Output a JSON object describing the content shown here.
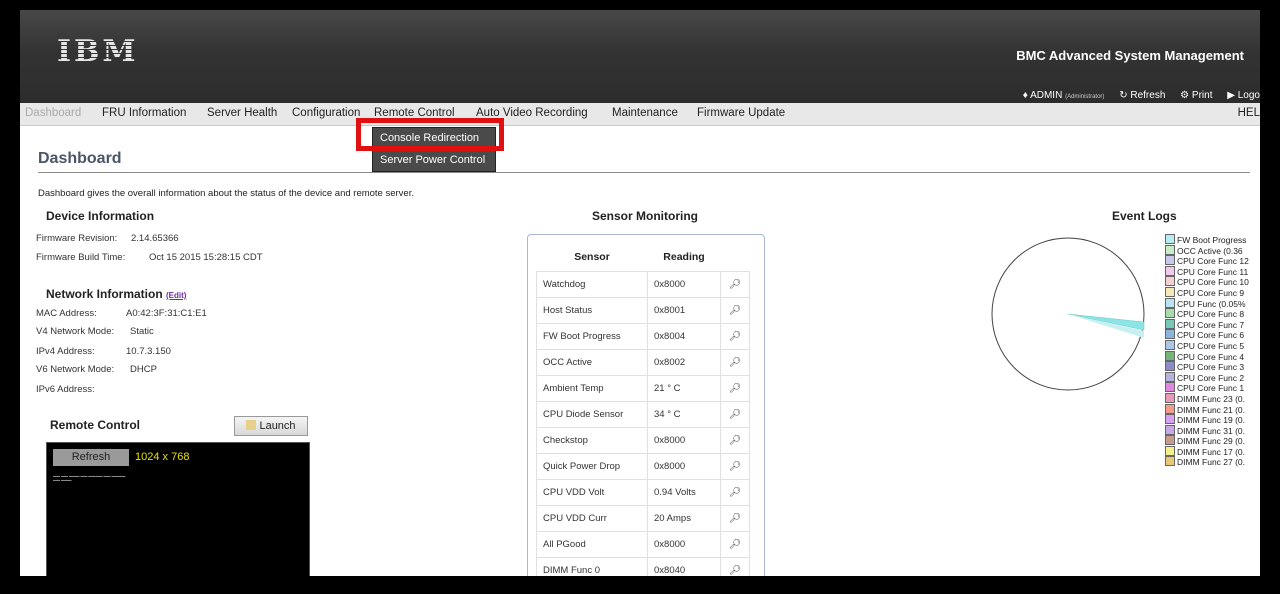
{
  "header": {
    "logo": "IBM",
    "product": "BMC Advanced System Management",
    "user": "ADMIN",
    "role": "(Administrator)",
    "refresh": "Refresh",
    "print": "Print",
    "logout": "Logo"
  },
  "nav": {
    "items": [
      "Dashboard",
      "FRU Information",
      "Server Health",
      "Configuration",
      "Remote Control",
      "Auto Video Recording",
      "Maintenance",
      "Firmware Update"
    ],
    "help": "HEL"
  },
  "submenu": {
    "items": [
      "Console Redirection",
      "Server Power Control"
    ]
  },
  "page": {
    "title": "Dashboard",
    "description": "Dashboard gives the overall information about the status of the device and remote server."
  },
  "device": {
    "heading": "Device Information",
    "fw_rev_label": "Firmware Revision:",
    "fw_rev": "2.14.65366",
    "fw_build_label": "Firmware Build Time:",
    "fw_build": "Oct 15 2015 15:28:15 CDT"
  },
  "network": {
    "heading": "Network Information",
    "edit": "(Edit)",
    "mac_label": "MAC Address:",
    "mac": "A0:42:3F:31:C1:E1",
    "v4mode_label": "V4 Network Mode:",
    "v4mode": "Static",
    "ipv4_label": "IPv4 Address:",
    "ipv4": "10.7.3.150",
    "v6mode_label": "V6 Network Mode:",
    "v6mode": "DHCP",
    "ipv6_label": "IPv6 Address:",
    "ipv6": ""
  },
  "remote": {
    "heading": "Remote Control",
    "launch": "Launch",
    "refresh": "Refresh",
    "resolution": "1024 x 768"
  },
  "sensors": {
    "heading": "Sensor Monitoring",
    "col_sensor": "Sensor",
    "col_reading": "Reading",
    "rows": [
      {
        "name": "Watchdog",
        "reading": "0x8000"
      },
      {
        "name": "Host Status",
        "reading": "0x8001"
      },
      {
        "name": "FW Boot Progress",
        "reading": "0x8004"
      },
      {
        "name": "OCC Active",
        "reading": "0x8002"
      },
      {
        "name": "Ambient Temp",
        "reading": "21 ° C"
      },
      {
        "name": "CPU Diode Sensor",
        "reading": "34 ° C"
      },
      {
        "name": "Checkstop",
        "reading": "0x8000"
      },
      {
        "name": "Quick Power Drop",
        "reading": "0x8000"
      },
      {
        "name": "CPU VDD Volt",
        "reading": "0.94 Volts"
      },
      {
        "name": "CPU VDD Curr",
        "reading": "20 Amps"
      },
      {
        "name": "All PGood",
        "reading": "0x8000"
      },
      {
        "name": "DIMM Func 0",
        "reading": "0x8040"
      }
    ]
  },
  "events": {
    "heading": "Event Logs",
    "legend": [
      {
        "label": "FW Boot Progress",
        "color": "#b8ecf4"
      },
      {
        "label": "OCC Active (0.36",
        "color": "#c8ecc8"
      },
      {
        "label": "CPU Core Func 12",
        "color": "#c8c8ec"
      },
      {
        "label": "CPU Core Func 11",
        "color": "#f4c8ec"
      },
      {
        "label": "CPU Core Func 10",
        "color": "#f4d0d0"
      },
      {
        "label": "CPU Core Func 9",
        "color": "#f4ecb8"
      },
      {
        "label": "CPU Func (0.05%",
        "color": "#b8e4f4"
      },
      {
        "label": "CPU Core Func 8",
        "color": "#a8dca8"
      },
      {
        "label": "CPU Core Func 7",
        "color": "#78c8b8"
      },
      {
        "label": "CPU Core Func 6",
        "color": "#8cb4dc"
      },
      {
        "label": "CPU Core Func 5",
        "color": "#a8c8e8"
      },
      {
        "label": "CPU Core Func 4",
        "color": "#78b478"
      },
      {
        "label": "CPU Core Func 3",
        "color": "#8c8cc8"
      },
      {
        "label": "CPU Core Func 2",
        "color": "#b4b4dc"
      },
      {
        "label": "CPU Core Func 1",
        "color": "#e088e0"
      },
      {
        "label": "DIMM Func 23 (0.",
        "color": "#e89ab8"
      },
      {
        "label": "DIMM Func 21 (0.",
        "color": "#f49c8c"
      },
      {
        "label": "DIMM Func 19 (0.",
        "color": "#d8a0f0"
      },
      {
        "label": "DIMM Func 31 (0.",
        "color": "#c8a8e8"
      },
      {
        "label": "DIMM Func 29 (0.",
        "color": "#c89c8c"
      },
      {
        "label": "DIMM Func 17 (0.",
        "color": "#f4f08c"
      },
      {
        "label": "DIMM Func 27 (0.",
        "color": "#e8c878"
      }
    ]
  }
}
